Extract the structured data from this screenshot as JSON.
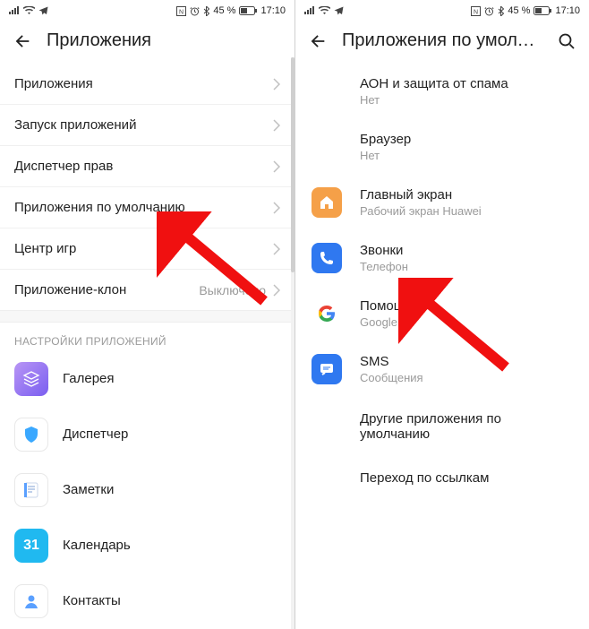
{
  "statusbar": {
    "battery_text": "45 %",
    "time": "17:10"
  },
  "left": {
    "title": "Приложения",
    "rows": [
      {
        "label": "Приложения",
        "value": ""
      },
      {
        "label": "Запуск приложений",
        "value": ""
      },
      {
        "label": "Диспетчер прав",
        "value": ""
      },
      {
        "label": "Приложения по умолчанию",
        "value": ""
      },
      {
        "label": "Центр игр",
        "value": ""
      },
      {
        "label": "Приложение-клон",
        "value": "Выключено"
      }
    ],
    "section_title": "НАСТРОЙКИ ПРИЛОЖЕНИЙ",
    "apps": [
      {
        "label": "Галерея"
      },
      {
        "label": "Диспетчер"
      },
      {
        "label": "Заметки"
      },
      {
        "label": "Календарь"
      },
      {
        "label": "Контакты"
      }
    ],
    "calendar_day": "31"
  },
  "right": {
    "title": "Приложения по умолча...",
    "defaults": [
      {
        "title": "АОН и защита от спама",
        "sub": "Нет",
        "icon": "none"
      },
      {
        "title": "Браузер",
        "sub": "Нет",
        "icon": "none"
      },
      {
        "title": "Главный экран",
        "sub": "Рабочий экран Huawei",
        "icon": "home"
      },
      {
        "title": "Звонки",
        "sub": "Телефон",
        "icon": "phone"
      },
      {
        "title": "Помощник",
        "sub": "Google",
        "icon": "google"
      },
      {
        "title": "SMS",
        "sub": "Сообщения",
        "icon": "sms"
      }
    ],
    "extra": [
      "Другие приложения по умолчанию",
      "Переход по ссылкам"
    ]
  }
}
